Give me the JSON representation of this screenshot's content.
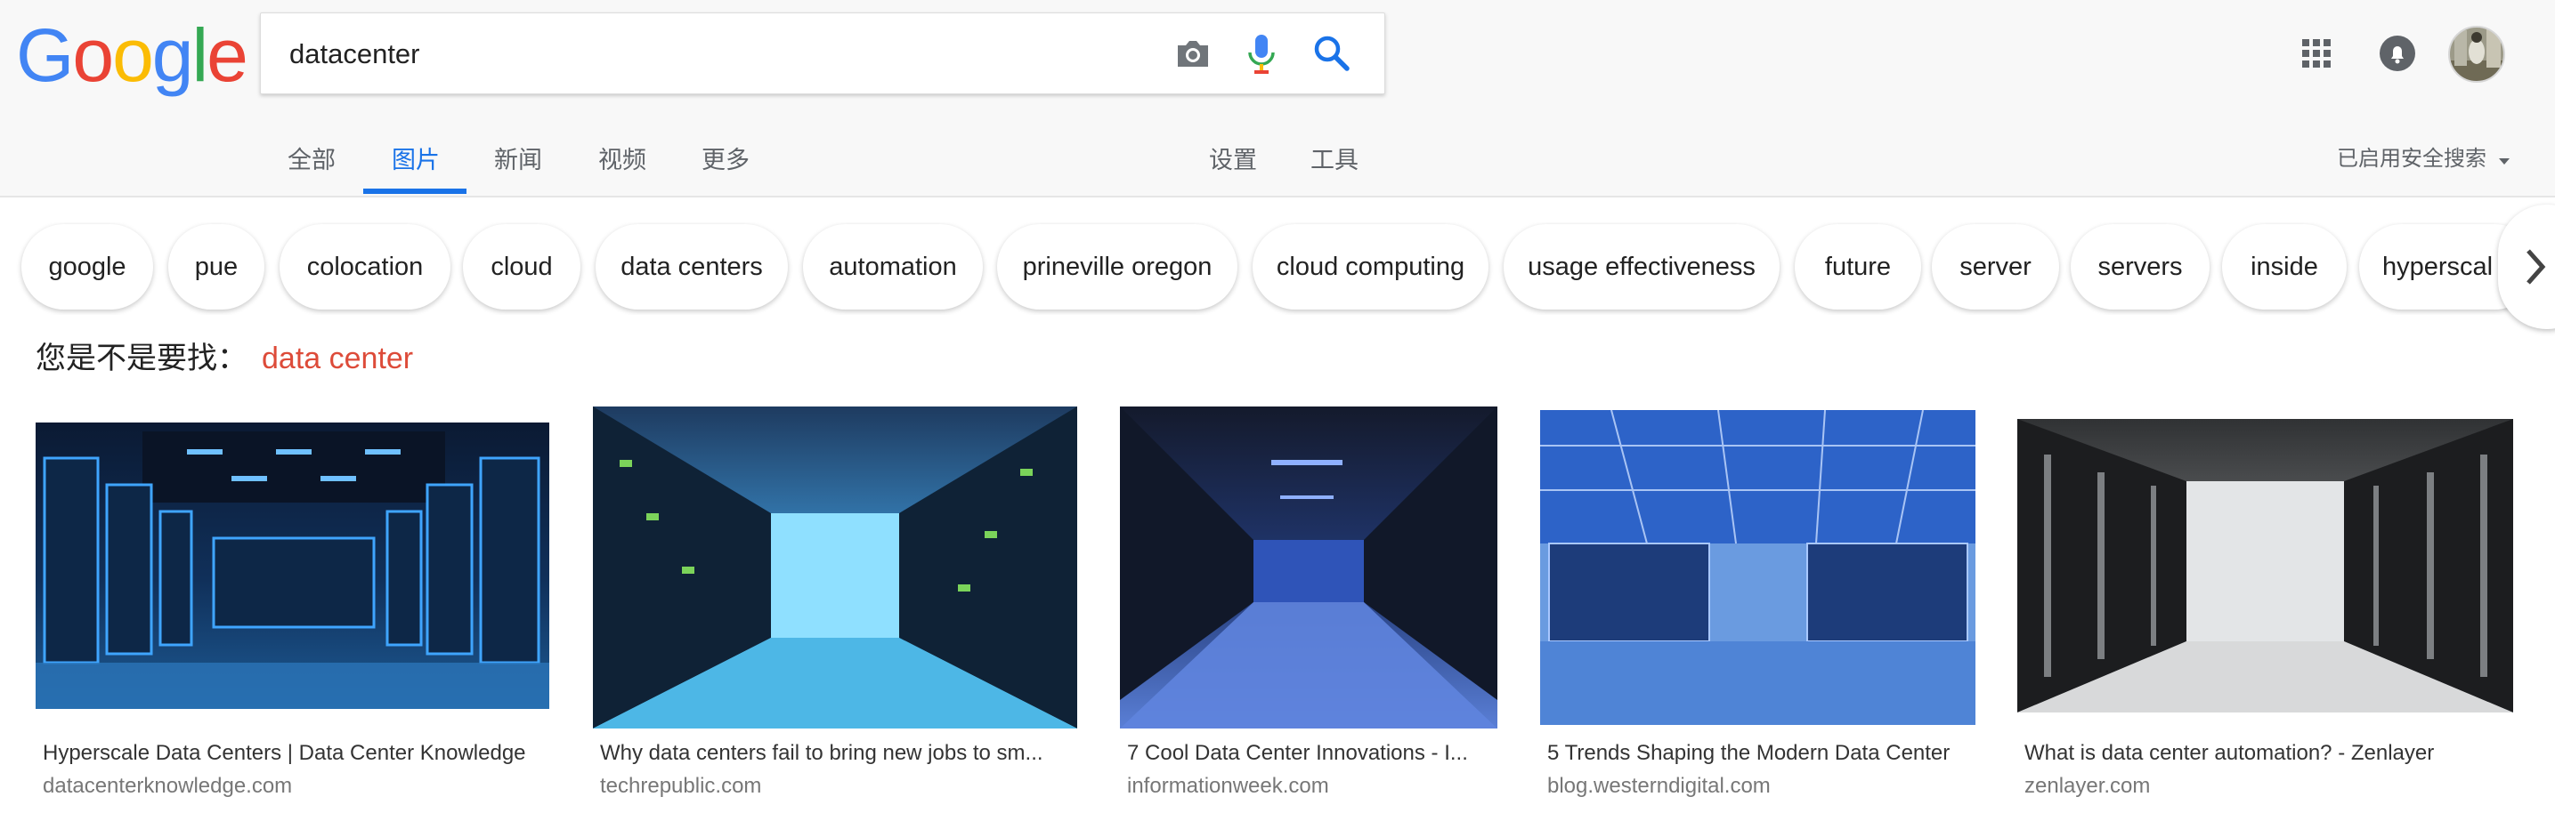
{
  "logo": {
    "letters": [
      "G",
      "o",
      "o",
      "g",
      "l",
      "e"
    ]
  },
  "search": {
    "query": "datacenter"
  },
  "tabs": [
    {
      "label": "全部"
    },
    {
      "label": "图片"
    },
    {
      "label": "新闻"
    },
    {
      "label": "视频"
    },
    {
      "label": "更多"
    }
  ],
  "tools": {
    "settings_label": "设置",
    "tools_label": "工具"
  },
  "safe_search": {
    "label": "已启用安全搜索"
  },
  "chips": [
    {
      "label": "google"
    },
    {
      "label": "pue"
    },
    {
      "label": "colocation"
    },
    {
      "label": "cloud"
    },
    {
      "label": "data centers"
    },
    {
      "label": "automation"
    },
    {
      "label": "prineville oregon"
    },
    {
      "label": "cloud computing"
    },
    {
      "label": "usage effectiveness"
    },
    {
      "label": "future"
    },
    {
      "label": "server"
    },
    {
      "label": "servers"
    },
    {
      "label": "inside"
    },
    {
      "label": "hyperscal"
    }
  ],
  "did_you_mean": {
    "prefix": "您是不是要找：",
    "suggestion": "data center"
  },
  "results": [
    {
      "title": "Hyperscale Data Centers | Data Center Knowledge",
      "site": "datacenterknowledge.com"
    },
    {
      "title": "Why data centers fail to bring new jobs to sm...",
      "site": "techrepublic.com"
    },
    {
      "title": "7 Cool Data Center Innovations - I...",
      "site": "informationweek.com"
    },
    {
      "title": "5 Trends Shaping the Modern Data Center",
      "site": "blog.westerndigital.com"
    },
    {
      "title": "What is data center automation? - Zenlayer",
      "site": "zenlayer.com"
    }
  ],
  "colors": {
    "accent": "#1a73e8",
    "suggestion": "#dd4b39",
    "logo_blue": "#4285f4",
    "logo_red": "#ea4335",
    "logo_yellow": "#fbbc05",
    "logo_green": "#34a853"
  }
}
